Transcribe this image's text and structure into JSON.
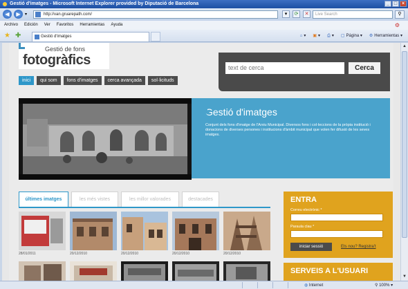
{
  "window": {
    "title": "Gestió d'imatges - Microsoft Internet Explorer provided by Diputació de Barcelona",
    "controls": [
      "_",
      "□",
      "×"
    ]
  },
  "addressbar": {
    "url": "http://van.gruarepath.com/",
    "search_placeholder": "Live Search",
    "back_icon": "back-arrow-icon",
    "forward_icon": "forward-arrow-icon"
  },
  "menubar": {
    "items": [
      "Archivo",
      "Edición",
      "Ver",
      "Favoritos",
      "Herramientas",
      "Ayuda"
    ]
  },
  "tabbar": {
    "active_tab": "Gestió d'imatges",
    "commands": [
      "Página",
      "Herramientas"
    ]
  },
  "site": {
    "logo_sub": "Gestió de fons",
    "logo_main": "fotogràfics",
    "search_placeholder": "text de cerca",
    "search_button": "Cerca",
    "nav": [
      "inici",
      "qui som",
      "fons d'imatges",
      "cerca avançada",
      "sol·licituds"
    ],
    "nav_active": 0,
    "hero_title": "Gestió d'imatges",
    "hero_text": "Conjunt dels fons d'imatge de l'Arxiu Municipal. Diversos fons i col·leccions de la pròpia institució i donacions de diverses persones i institucions d'àmbit municipal que volen fer difusió de les seves imatges.",
    "tabs": [
      "últimes imatges",
      "les més vistes",
      "les millor valorades",
      "destacades"
    ],
    "tabs_active": 0,
    "thumbnails": [
      {
        "date": "28/01/2011"
      },
      {
        "date": "20/12/2010"
      },
      {
        "date": "20/12/2010"
      },
      {
        "date": "20/12/2010"
      },
      {
        "date": "20/12/2010"
      }
    ],
    "login": {
      "title": "ENTRA",
      "email_label": "Correu electrònic *",
      "password_label": "Paraula clau *",
      "button": "iniciar sessió",
      "register_link": "Ets nou? Registra't"
    },
    "services_title": "SERVEIS A L'USUARI"
  },
  "statusbar": {
    "zone": "Internet",
    "zoom": "100%"
  }
}
